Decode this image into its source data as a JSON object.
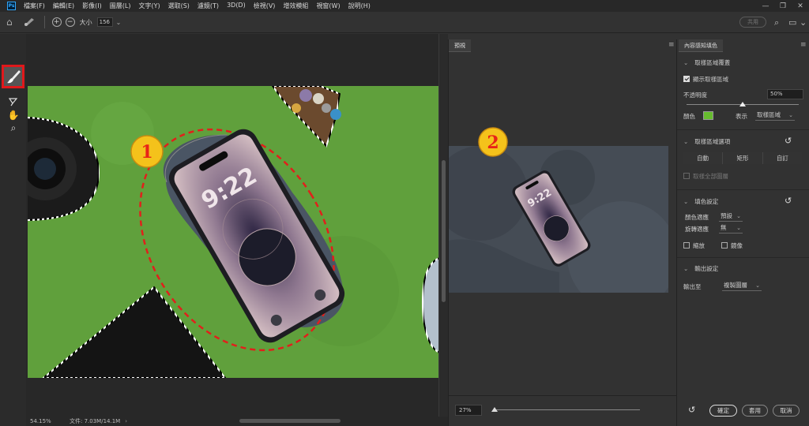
{
  "menubar": {
    "logo": "Ps",
    "items": [
      "檔案(F)",
      "編輯(E)",
      "影像(I)",
      "圖層(L)",
      "文字(Y)",
      "選取(S)",
      "濾鏡(T)",
      "3D(D)",
      "檢視(V)",
      "增效模組",
      "視窗(W)",
      "說明(H)"
    ],
    "window_buttons": [
      "—",
      "❐",
      "✕"
    ]
  },
  "options": {
    "size_label": "大小",
    "size_value": "156",
    "share_label": "共用"
  },
  "annotations": {
    "marker1": "1",
    "marker2": "2"
  },
  "status": {
    "zoom": "54.15%",
    "doc": "文件: 7.03M/14.1M",
    "arrow": "›"
  },
  "preview": {
    "tab": "預視",
    "zoom": "27%",
    "zoom_fraction": 0.01
  },
  "properties": {
    "tab": "內容感知填色",
    "sampling": {
      "title": "取樣區域覆蓋",
      "show_label": "顯示取樣區域",
      "show_checked": true,
      "opacity_label": "不透明度",
      "opacity_value": "50%",
      "opacity_fraction": 0.5,
      "color_label": "顏色",
      "color": "#66bb2e",
      "indicates_label": "表示",
      "indicates_value": "取樣區域"
    },
    "sampling_options": {
      "title": "取樣區域選項",
      "modes": [
        "自動",
        "矩形",
        "自訂"
      ],
      "sample_all_label": "取樣全部圖層"
    },
    "fill_settings": {
      "title": "填色設定",
      "color_adapt_label": "顏色適應",
      "color_adapt_value": "預設",
      "rotation_adapt_label": "旋轉適應",
      "rotation_adapt_value": "無",
      "scale_label": "縮放",
      "mirror_label": "鏡像"
    },
    "output": {
      "title": "輸出設定",
      "output_to_label": "輸出至",
      "output_to_value": "複製圖層"
    },
    "buttons": {
      "ok": "確定",
      "apply": "套用",
      "cancel": "取消"
    }
  },
  "phone": {
    "time": "9:22"
  }
}
